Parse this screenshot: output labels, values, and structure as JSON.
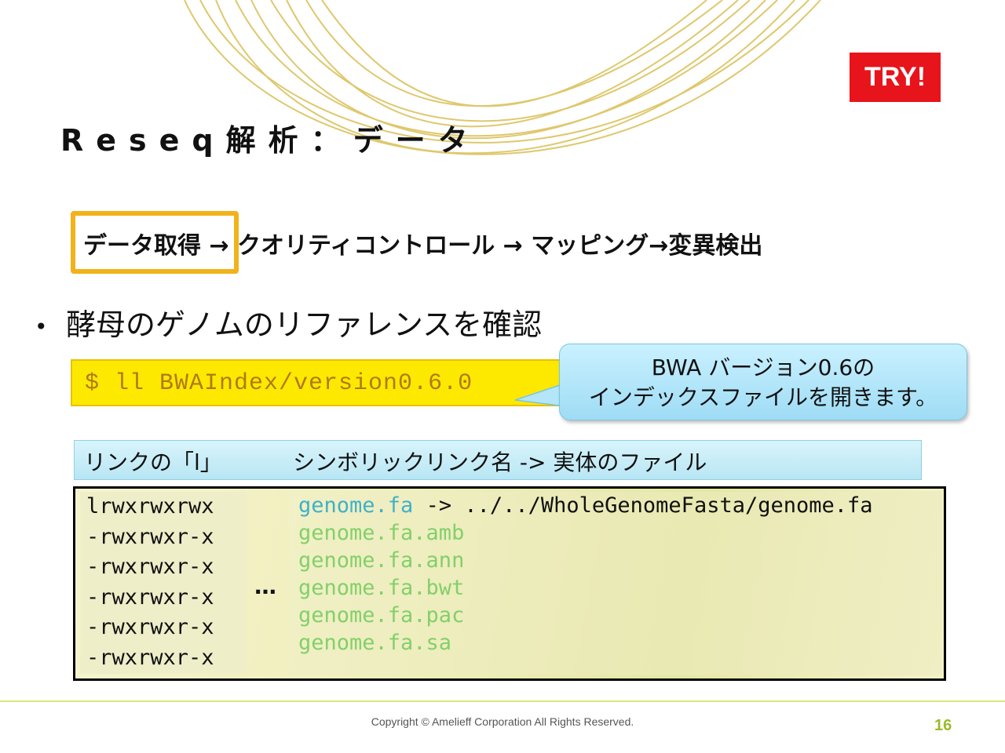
{
  "badge": {
    "label": "TRY!",
    "color": "#e8141b"
  },
  "title": "Reseq解析：データ",
  "workflow": {
    "current_step": "データ取得",
    "rest": " → クオリティコントロール → マッピング→変異検出",
    "highlight_color": "#f2b21b"
  },
  "bullet": {
    "marker": "•",
    "text": "酵母のゲノムのリファレンスを確認"
  },
  "command": {
    "text": "$ ll BWAIndex/version0.6.0",
    "background": "#fde900"
  },
  "callout": {
    "line1": "BWA バージョン0.6の",
    "line2": "インデックスファイルを開きます。"
  },
  "caption": {
    "part1": "リンクの「l」",
    "part2": "シンボリックリンク名 -> 実体のファイル"
  },
  "listing": {
    "permissions": [
      "lrwxrwxrwx",
      "-rwxrwxr-x",
      "-rwxrwxr-x",
      "-rwxrwxr-x",
      "-rwxrwxr-x",
      "-rwxrwxr-x"
    ],
    "ellipsis": "…",
    "files": [
      {
        "name": "genome.fa",
        "target": "-> ../../WholeGenomeFasta/genome.fa"
      },
      {
        "name": "genome.fa.amb"
      },
      {
        "name": "genome.fa.ann"
      },
      {
        "name": "genome.fa.bwt"
      },
      {
        "name": "genome.fa.pac"
      },
      {
        "name": "genome.fa.sa"
      }
    ]
  },
  "footer": {
    "copyright": "Copyright © Amelieff Corporation All Rights Reserved.",
    "page_number": "16"
  }
}
